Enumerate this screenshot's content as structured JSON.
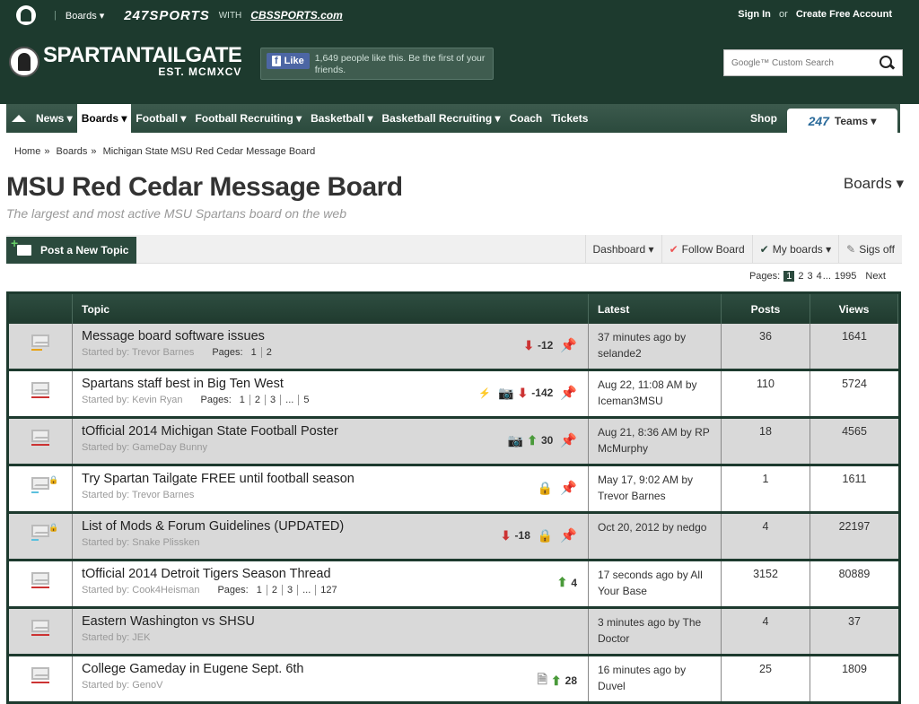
{
  "topbar": {
    "boards": "Boards ▾",
    "brand": "247SPORTS",
    "with": "WITH",
    "cbs": "CBSSPORTS.com",
    "sign_in": "Sign In",
    "or": "or",
    "create": "Create Free Account"
  },
  "header": {
    "site_name": "SPARTANTAILGATE",
    "site_sub": "EST. MCMXCV",
    "fb_like": "Like",
    "fb_text": "1,649 people like this. Be the first of your friends.",
    "search_placeholder": "Google™ Custom Search"
  },
  "nav": {
    "items": [
      "News ▾",
      "Boards ▾",
      "Football ▾",
      "Football Recruiting ▾",
      "Basketball ▾",
      "Basketball Recruiting ▾",
      "Coach",
      "Tickets"
    ],
    "shop": "Shop",
    "teams_logo": "247",
    "teams": "Teams ▾"
  },
  "breadcrumb": [
    "Home",
    "Boards",
    "Michigan State MSU Red Cedar Message Board"
  ],
  "page": {
    "title": "MSU Red Cedar Message Board",
    "subtitle": "The largest and most active MSU Spartans board on the web",
    "boards_menu": "Boards ▾"
  },
  "toolbar": {
    "post": "Post a New Topic",
    "dashboard": "Dashboard ▾",
    "follow": "Follow Board",
    "myboards": "My boards ▾",
    "sigs": "Sigs off"
  },
  "pagination": {
    "label": "Pages:",
    "pages": [
      "1",
      "2",
      "3",
      "4",
      "...",
      "1995"
    ],
    "next": "Next"
  },
  "table": {
    "headers": [
      "Topic",
      "Latest",
      "Posts",
      "Views"
    ],
    "rows": [
      {
        "title": "Message board software issues",
        "starter": "Started by: Trevor Barnes",
        "pages": [
          "1",
          "2"
        ],
        "score": "-12",
        "latest": "37 minutes ago by selande2",
        "posts": "36",
        "views": "1641"
      },
      {
        "title": "Spartans staff best in Big Ten West",
        "starter": "Started by: Kevin Ryan",
        "pages": [
          "1",
          "2",
          "3",
          "...",
          "5"
        ],
        "score": "-142",
        "latest": "Aug 22, 11:08 AM by Iceman3MSU",
        "posts": "110",
        "views": "5724"
      },
      {
        "title": "tOfficial 2014 Michigan State Football Poster",
        "starter": "Started by: GameDay Bunny",
        "pages": [],
        "score": "30",
        "latest": "Aug 21, 8:36 AM by RP McMurphy",
        "posts": "18",
        "views": "4565"
      },
      {
        "title": "Try Spartan Tailgate FREE until football season",
        "starter": "Started by: Trevor Barnes",
        "pages": [],
        "score": "",
        "latest": "May 17, 9:02 AM by Trevor Barnes",
        "posts": "1",
        "views": "1611"
      },
      {
        "title": "List of Mods & Forum Guidelines (UPDATED)",
        "starter": "Started by: Snake Plissken",
        "pages": [],
        "score": "-18",
        "latest": "Oct 20, 2012 by nedgo",
        "posts": "4",
        "views": "22197"
      },
      {
        "title": "tOfficial 2014 Detroit Tigers Season Thread",
        "starter": "Started by: Cook4Heisman",
        "pages": [
          "1",
          "2",
          "3",
          "...",
          "127"
        ],
        "score": "4",
        "latest": "17 seconds ago by All Your Base",
        "posts": "3152",
        "views": "80889"
      },
      {
        "title": "Eastern Washington vs SHSU",
        "starter": "Started by: JEK",
        "pages": [],
        "score": "",
        "latest": "3 minutes ago by The Doctor",
        "posts": "4",
        "views": "37"
      },
      {
        "title": "College Gameday in Eugene Sept. 6th",
        "starter": "Started by: GenoV",
        "pages": [],
        "score": "28",
        "latest": "16 minutes ago by Duvel",
        "posts": "25",
        "views": "1809"
      }
    ]
  }
}
